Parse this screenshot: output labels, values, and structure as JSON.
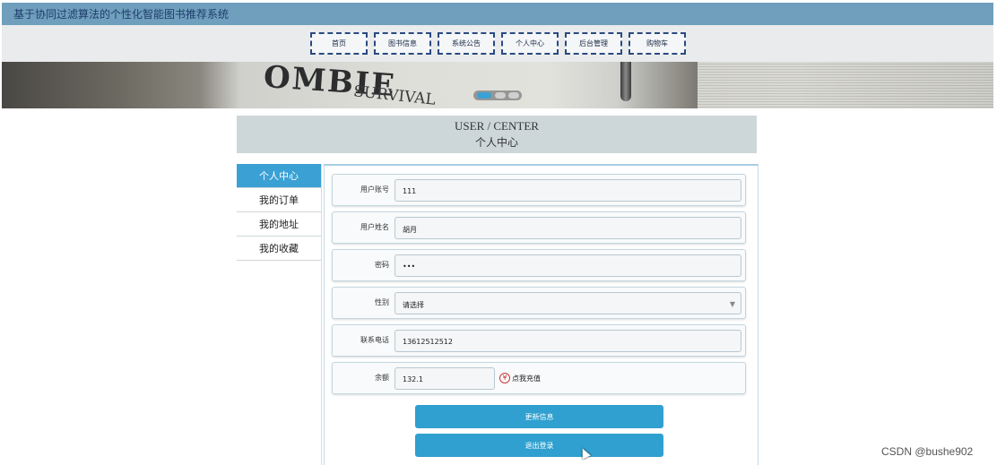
{
  "app": {
    "title": "基于协同过滤算法的个性化智能图书推荐系统"
  },
  "nav": {
    "items": [
      {
        "label": "首页"
      },
      {
        "label": "图书信息"
      },
      {
        "label": "系统公告"
      },
      {
        "label": "个人中心"
      },
      {
        "label": "后台管理"
      },
      {
        "label": "购物车"
      }
    ]
  },
  "banner": {
    "text": "OMBIE",
    "subtext": "SURVIVAL",
    "slide_count": 3,
    "active_slide": 1
  },
  "center": {
    "title_en": "USER / CENTER",
    "title_zh": "个人中心"
  },
  "sidebar": {
    "items": [
      {
        "label": "个人中心",
        "active": true
      },
      {
        "label": "我的订单"
      },
      {
        "label": "我的地址"
      },
      {
        "label": "我的收藏"
      }
    ]
  },
  "form": {
    "username": {
      "label": "用户账号",
      "value": "111"
    },
    "name": {
      "label": "用户姓名",
      "value": "胡月"
    },
    "password": {
      "label": "密码",
      "value": "•••"
    },
    "gender": {
      "label": "性别",
      "value": "请选择"
    },
    "phone": {
      "label": "联系电话",
      "value": "13612512512"
    },
    "balance": {
      "label": "余额",
      "value": "132.1",
      "recharge_label": "点我充值",
      "recharge_icon_text": "¥"
    }
  },
  "buttons": {
    "update": "更新信息",
    "logout": "退出登录"
  },
  "watermark": "CSDN @bushe902",
  "colors": {
    "header": "#6f9fbd",
    "accent": "#3ba1d4",
    "button": "#2fa0cf",
    "nav_border": "#2a4a80"
  }
}
